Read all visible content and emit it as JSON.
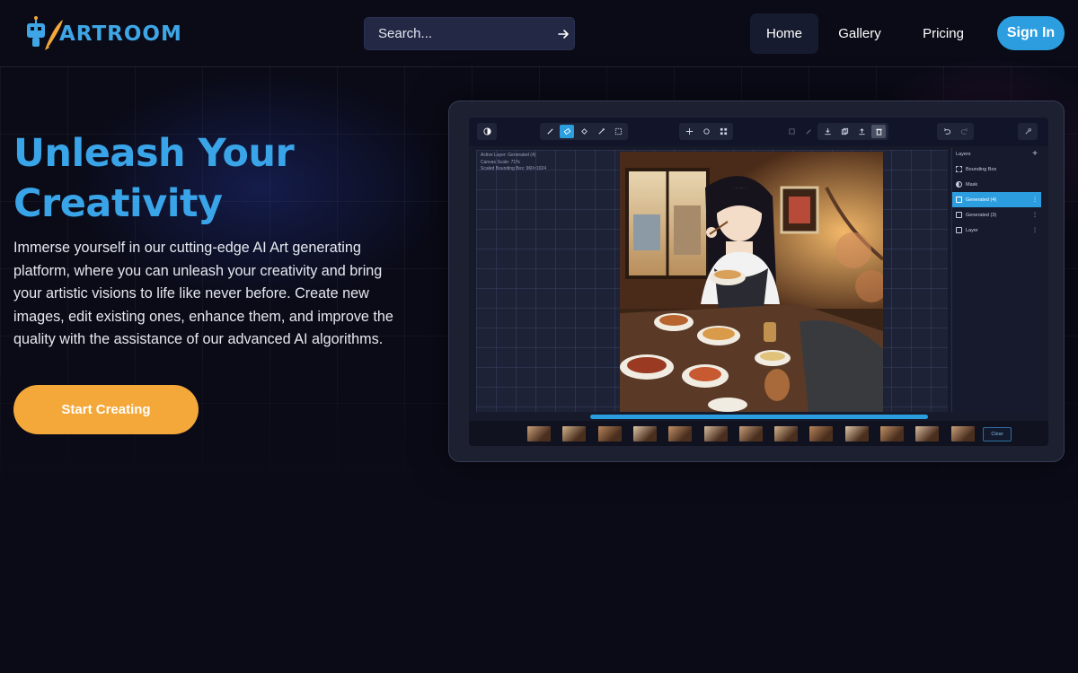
{
  "brand": {
    "name": "ARTROOM",
    "accent": "#3ea6e6",
    "cta": "#f4a83a"
  },
  "search": {
    "placeholder": "Search..."
  },
  "nav": {
    "home": "Home",
    "gallery": "Gallery",
    "pricing": "Pricing",
    "signin": "Sign In"
  },
  "hero": {
    "title": "Unleash Your Creativity",
    "description": "Immerse yourself in our cutting-edge AI Art generating platform, where you can unleash your creativity and bring your artistic visions to life like never before. Create new images, edit existing ones, enhance them, and improve the quality with the assistance of our advanced AI algorithms.",
    "cta": "Start Creating"
  },
  "editor": {
    "info": [
      "Active Layer: Generated (4)",
      "Canvas Scale: 71%",
      "Scaled Bounding Box: 960×1024"
    ],
    "layers_title": "Layers",
    "layers": [
      {
        "label": "Bounding Box",
        "icon": "bounding-box-icon",
        "active": false
      },
      {
        "label": "Mask",
        "icon": "mask-icon",
        "active": false
      },
      {
        "label": "Generated (4)",
        "icon": "image-icon",
        "active": true
      },
      {
        "label": "Generated (3)",
        "icon": "image-icon",
        "active": false
      },
      {
        "label": "Layer",
        "icon": "image-icon",
        "active": false
      }
    ],
    "clear_label": "Clear",
    "thumbnail_count": 13
  }
}
